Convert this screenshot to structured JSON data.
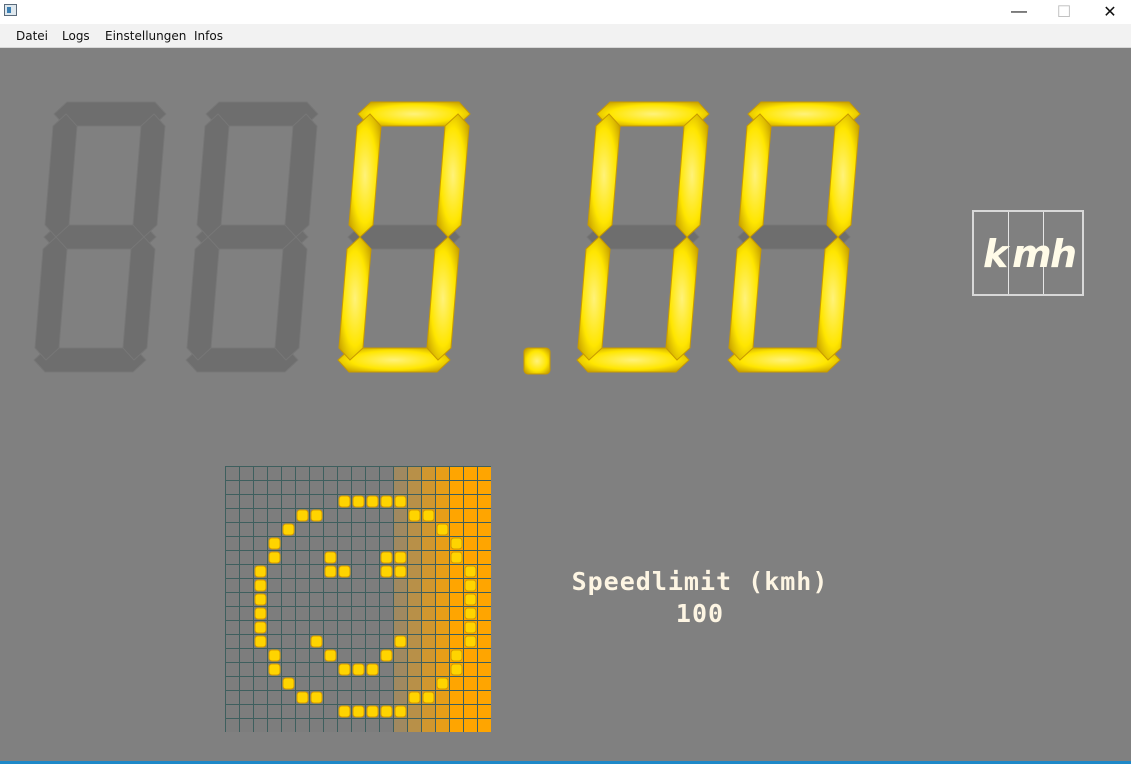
{
  "window": {
    "minimize_glyph": "—",
    "maximize_glyph": "☐",
    "close_glyph": "✕"
  },
  "menu": [
    {
      "label": "Datei"
    },
    {
      "label": "Logs"
    },
    {
      "label": "Einstellungen"
    },
    {
      "label": "Infos"
    }
  ],
  "speed_display": {
    "text": "0.00",
    "digits": [
      "",
      "",
      "0",
      "0",
      "0"
    ],
    "decimal_after_digit": 3,
    "lit_color": "#ffee00",
    "unlit_color": "#6e6e6e"
  },
  "unit": {
    "letters": [
      "k",
      "m",
      "h"
    ]
  },
  "speedlimit": {
    "label": "Speedlimit (kmh)",
    "value": "100"
  },
  "smiley_matrix": {
    "icon": "smiley-face-icon",
    "columns": 19,
    "rows": 19,
    "lit_color": "#ffd400",
    "gradient_color": "#ffa500",
    "grid_color": "#3e5f5e",
    "background_color": "#7d7d7d"
  }
}
